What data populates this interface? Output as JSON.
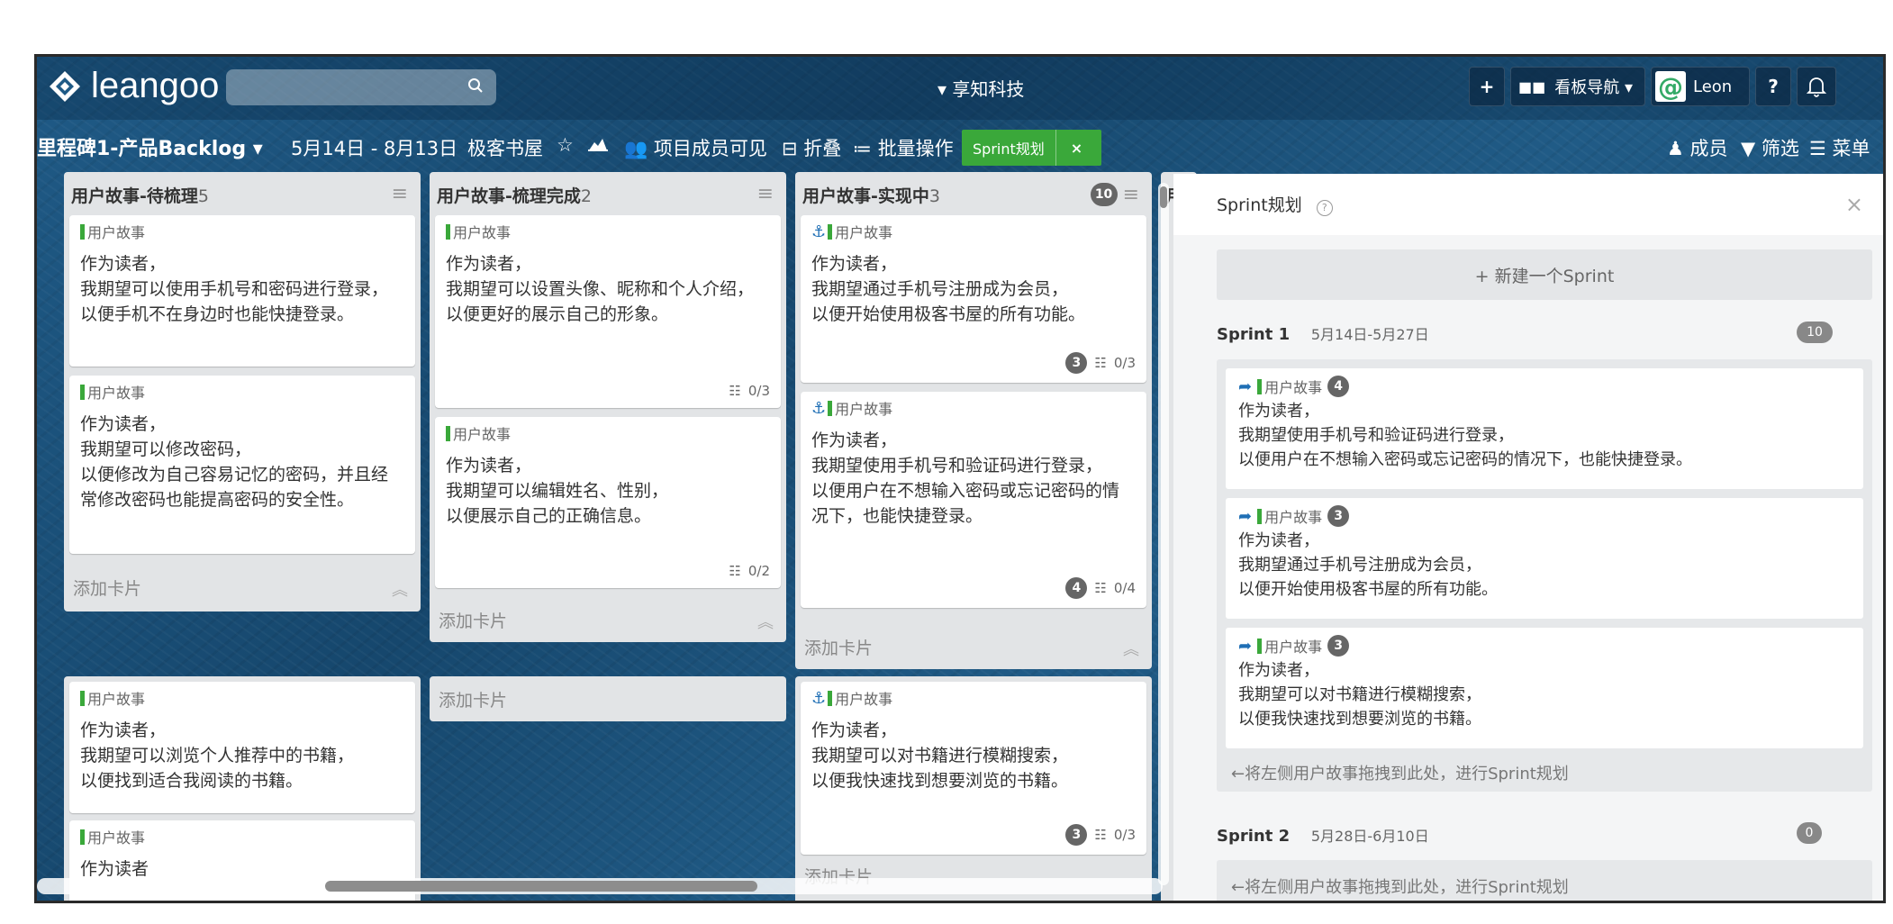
{
  "app": {
    "logo_text": "leangoo",
    "search_placeholder": "",
    "company": "▾ 享知科技"
  },
  "topbar": {
    "add_label": "+",
    "board_nav_label": "看板导航 ▾",
    "user_name": "Leon",
    "help_label": "?",
    "colors": {
      "accent_green": "#3aa83a",
      "link_blue": "#1f6fb5"
    }
  },
  "board": {
    "title": "里程碑1-产品Backlog ▾",
    "date_range": "5月14日 - 8月13日",
    "project": "极客书屋",
    "star_icon": "☆",
    "visibility": "项目成员可见",
    "fold": "折叠",
    "batch": "批量操作",
    "sprint_plan_btn": "Sprint规划",
    "sprint_plan_close": "×",
    "members": "成员",
    "filter": "筛选",
    "menu": "菜单"
  },
  "lists": [
    {
      "title": "用户故事-待梳理",
      "count": "5",
      "cards": [
        {
          "tag": "用户故事",
          "desc": "作为读者，\n我期望可以使用手机号和密码进行登录，\n以便手机不在身边时也能快捷登录。"
        },
        {
          "tag": "用户故事",
          "desc": "作为读者，\n我期望可以修改密码，\n以便修改为自己容易记忆的密码，并且经常修改密码也能提高密码的安全性。"
        }
      ],
      "add_card": "添加卡片",
      "cards2": [
        {
          "tag": "用户故事",
          "desc": "作为读者，\n我期望可以浏览个人推荐中的书籍，\n以便找到适合我阅读的书籍。"
        },
        {
          "tag": "用户故事",
          "desc": "作为读者"
        }
      ]
    },
    {
      "title": "用户故事-梳理完成",
      "count": "2",
      "cards": [
        {
          "tag": "用户故事",
          "desc": "作为读者，\n我期望可以设置头像、昵称和个人介绍，\n以便更好的展示自己的形象。",
          "tasks": "0/3"
        },
        {
          "tag": "用户故事",
          "desc": "作为读者，\n我期望可以编辑姓名、性别，\n以便展示自己的正确信息。",
          "tasks": "0/2"
        }
      ],
      "add_card": "添加卡片",
      "add_card2": "添加卡片"
    },
    {
      "title": "用户故事-实现中",
      "count": "3",
      "badge": "10",
      "cards": [
        {
          "tag": "用户故事",
          "desc": "作为读者，\n我期望通过手机号注册成为会员，\n以便开始使用极客书屋的所有功能。",
          "points": "3",
          "tasks": "0/3"
        },
        {
          "tag": "用户故事",
          "desc": "作为读者，\n我期望使用手机号和验证码进行登录，\n以便用户在不想输入密码或忘记密码的情况下，也能快捷登录。",
          "points": "4",
          "tasks": "0/4"
        }
      ],
      "add_card": "添加卡片",
      "cards2": [
        {
          "tag": "用户故事",
          "desc": "作为读者，\n我期望可以对书籍进行模糊搜索，\n以便我快速找到想要浏览的书籍。",
          "points": "3",
          "tasks": "0/3"
        }
      ],
      "add_card2": "添加卡片"
    },
    {
      "title": "用"
    }
  ],
  "sprint_panel": {
    "title": "Sprint规划",
    "help_icon": "?",
    "close": "×",
    "new_sprint": "+  新建一个Sprint",
    "sprints": [
      {
        "name": "Sprint 1",
        "dates": "5月14日-5月27日",
        "count": "10",
        "cards": [
          {
            "tag": "用户故事",
            "points": "4",
            "desc": "作为读者，\n我期望使用手机号和验证码进行登录，\n以便用户在不想输入密码或忘记密码的情况下，也能快捷登录。"
          },
          {
            "tag": "用户故事",
            "points": "3",
            "desc": "作为读者，\n我期望通过手机号注册成为会员，\n以便开始使用极客书屋的所有功能。"
          },
          {
            "tag": "用户故事",
            "points": "3",
            "desc": "作为读者，\n我期望可以对书籍进行模糊搜索，\n以便我快速找到想要浏览的书籍。"
          }
        ],
        "hint": "←将左侧用户故事拖拽到此处，进行Sprint规划"
      },
      {
        "name": "Sprint 2",
        "dates": "5月28日-6月10日",
        "count": "0",
        "hint": "←将左侧用户故事拖拽到此处，进行Sprint规划"
      }
    ]
  }
}
